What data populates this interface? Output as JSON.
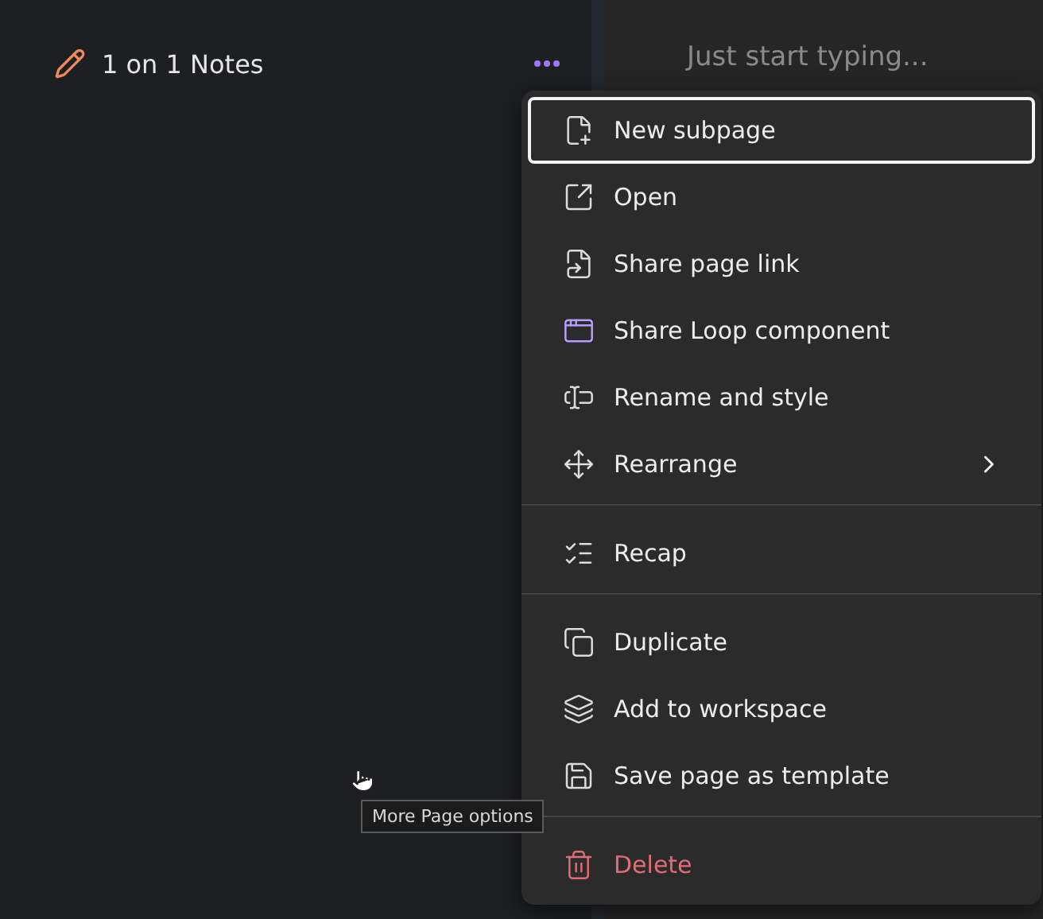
{
  "page_item": {
    "title": "1 on 1 Notes"
  },
  "editor": {
    "placeholder": "Just start typing..."
  },
  "menu": {
    "groups": [
      {
        "items": [
          {
            "label": "New subpage",
            "selected": true,
            "kind": "normal",
            "submenu": false
          },
          {
            "label": "Open",
            "selected": false,
            "kind": "normal",
            "submenu": false
          },
          {
            "label": "Share page link",
            "selected": false,
            "kind": "normal",
            "submenu": false
          },
          {
            "label": "Share Loop component",
            "selected": false,
            "kind": "normal",
            "submenu": false
          },
          {
            "label": "Rename and style",
            "selected": false,
            "kind": "normal",
            "submenu": false
          },
          {
            "label": "Rearrange",
            "selected": false,
            "kind": "normal",
            "submenu": true
          }
        ]
      },
      {
        "items": [
          {
            "label": "Recap",
            "selected": false,
            "kind": "normal",
            "submenu": false
          }
        ]
      },
      {
        "items": [
          {
            "label": "Duplicate",
            "selected": false,
            "kind": "normal",
            "submenu": false
          },
          {
            "label": "Add to workspace",
            "selected": false,
            "kind": "normal",
            "submenu": false
          },
          {
            "label": "Save page as template",
            "selected": false,
            "kind": "normal",
            "submenu": false
          }
        ]
      },
      {
        "items": [
          {
            "label": "Delete",
            "selected": false,
            "kind": "danger",
            "submenu": false
          }
        ]
      }
    ]
  },
  "tooltip": {
    "text": "More Page options"
  }
}
